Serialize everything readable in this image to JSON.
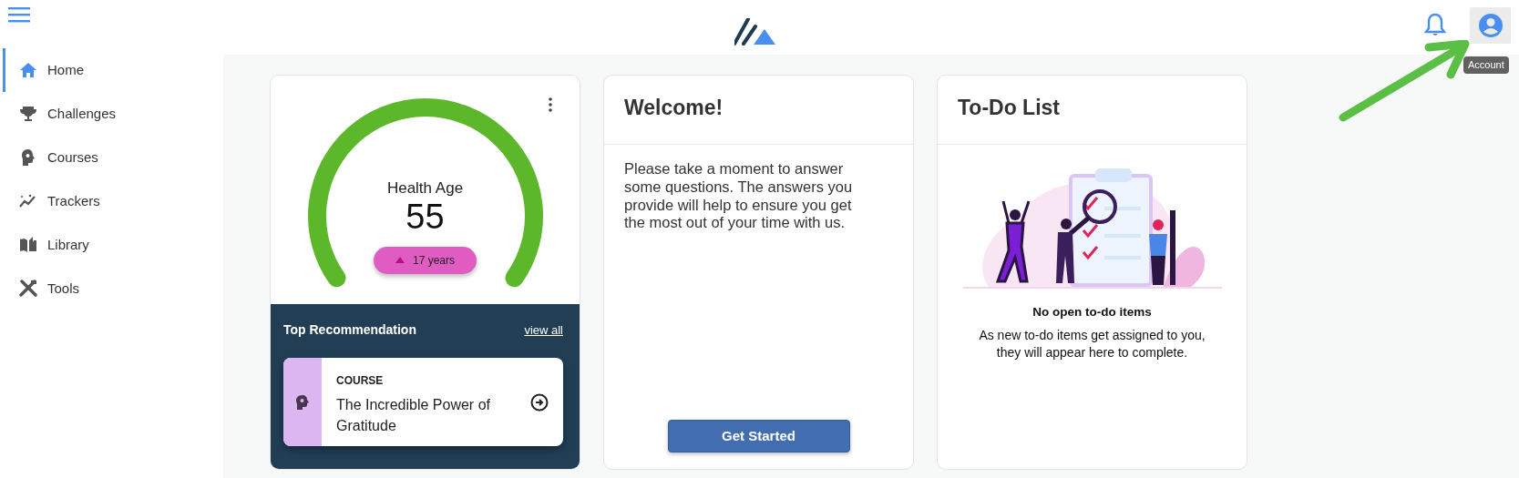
{
  "header": {
    "account": {
      "tooltip": "Account"
    }
  },
  "sidebar": {
    "items": [
      {
        "label": "Home",
        "kind": "home",
        "selected": true
      },
      {
        "label": "Challenges",
        "kind": "trophy",
        "selected": false
      },
      {
        "label": "Courses",
        "kind": "head",
        "selected": false
      },
      {
        "label": "Trackers",
        "kind": "trend",
        "selected": false
      },
      {
        "label": "Library",
        "kind": "book",
        "selected": false
      },
      {
        "label": "Tools",
        "kind": "tools",
        "selected": false
      }
    ]
  },
  "health_card": {
    "title": "Health Age",
    "value": "55",
    "change": {
      "increase": true,
      "text": "17 years"
    },
    "recommendation": {
      "title": "Top Recommendation",
      "link": "view all",
      "item": {
        "type": "COURSE",
        "title": "The Incredible Power of Gratitude"
      }
    }
  },
  "welcome_card": {
    "title": "Welcome!",
    "text": "Please take a moment to answer some questions. The answers you provide will help to ensure you get the most out of your time with us.",
    "button": "Get Started"
  },
  "todo_card": {
    "title": "To-Do List",
    "empty_title": "No open to-do items",
    "empty_text": "As new to-do items get assigned to you, they will appear here to complete."
  }
}
